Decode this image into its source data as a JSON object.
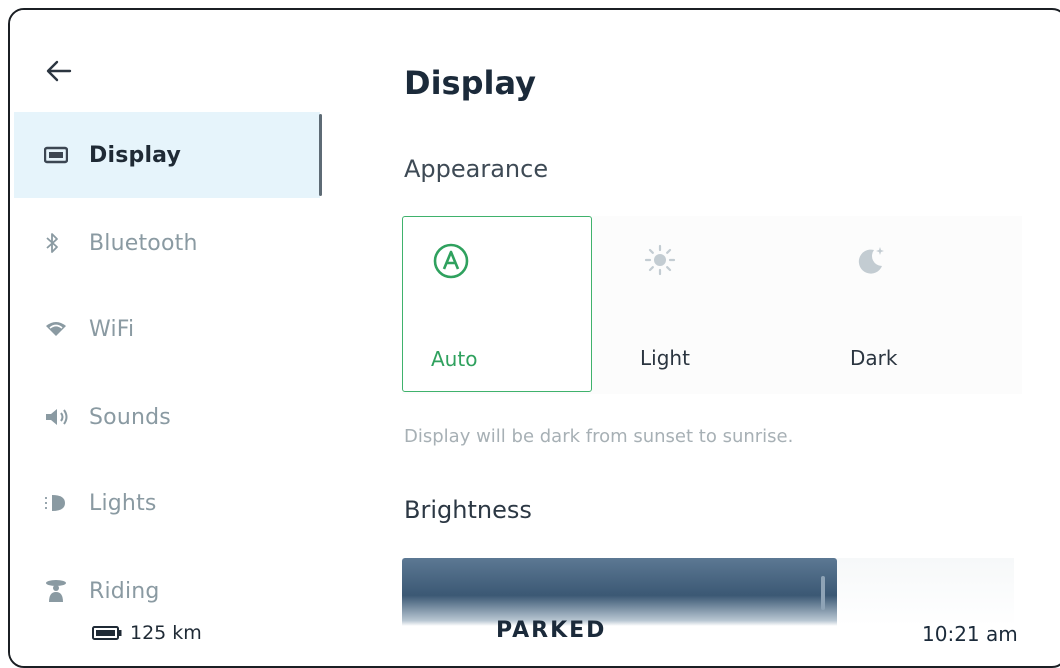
{
  "sidebar": {
    "back_icon": "arrow-left-icon",
    "items": [
      {
        "label": "Display",
        "icon": "monitor-icon",
        "active": true
      },
      {
        "label": "Bluetooth",
        "icon": "bluetooth-icon",
        "active": false
      },
      {
        "label": "WiFi",
        "icon": "wifi-icon",
        "active": false
      },
      {
        "label": "Sounds",
        "icon": "speaker-icon",
        "active": false
      },
      {
        "label": "Lights",
        "icon": "light-icon",
        "active": false
      },
      {
        "label": "Riding",
        "icon": "rider-icon",
        "active": false
      }
    ],
    "battery": {
      "icon": "battery-icon",
      "range": "125 km"
    }
  },
  "main": {
    "title": "Display",
    "appearance": {
      "heading": "Appearance",
      "options": [
        {
          "label": "Auto",
          "icon": "auto-a-icon",
          "selected": true
        },
        {
          "label": "Light",
          "icon": "sun-icon",
          "selected": false
        },
        {
          "label": "Dark",
          "icon": "moon-icon",
          "selected": false
        }
      ],
      "description": "Display will be dark from sunset to sunrise."
    },
    "brightness": {
      "heading": "Brightness",
      "level": 0.71
    }
  },
  "status": {
    "mode": "PARKED",
    "time": "10:21 am"
  },
  "colors": {
    "accent": "#2fa15e",
    "active_bg": "#e6f4fb",
    "slider": "#3b5874"
  }
}
